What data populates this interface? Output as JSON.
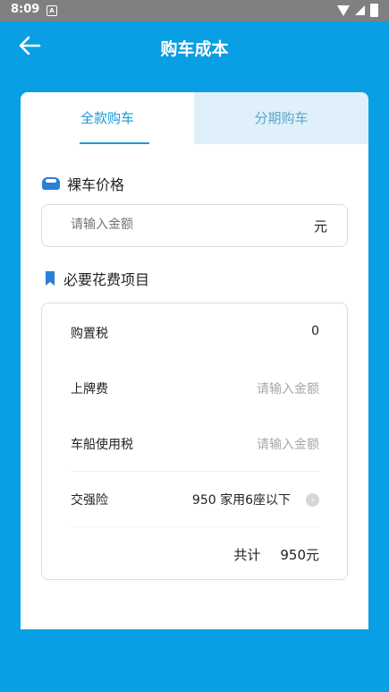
{
  "status": {
    "time": "8:09",
    "notif": "A"
  },
  "header": {
    "title": "购车成本"
  },
  "tabs": [
    {
      "label": "全款购车"
    },
    {
      "label": "分期购车"
    }
  ],
  "bare_price": {
    "title": "裸车价格",
    "placeholder": "请输入金额",
    "unit": "元"
  },
  "fees": {
    "title": "必要花费项目",
    "items": [
      {
        "label": "购置税",
        "value": "0"
      },
      {
        "label": "上牌费",
        "placeholder": "请输入金额"
      },
      {
        "label": "车船使用税",
        "placeholder": "请输入金额"
      },
      {
        "label": "交强险",
        "value": "950 家用6座以下"
      }
    ],
    "total_label": "共计",
    "total_value": "950元"
  }
}
